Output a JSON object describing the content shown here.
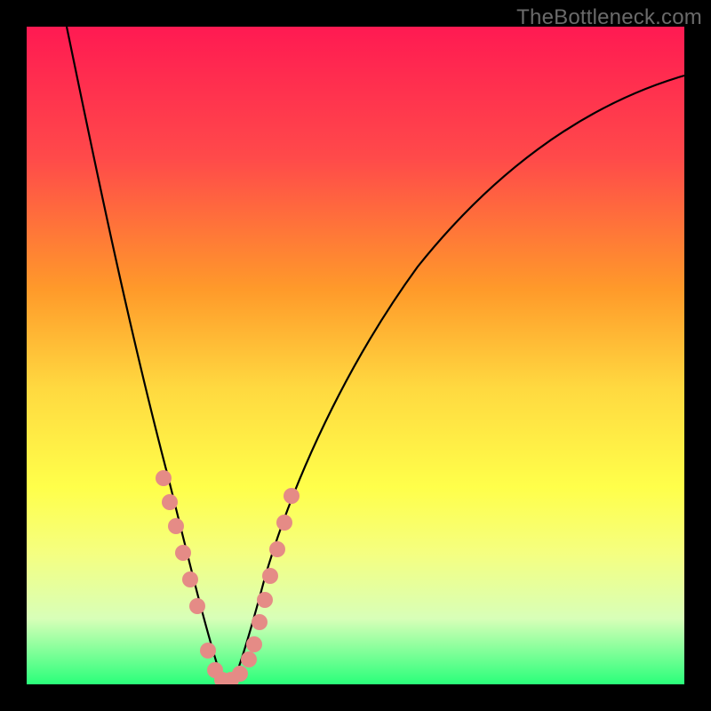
{
  "watermark": "TheBottleneck.com",
  "colors": {
    "frame": "#000000",
    "gradient_top": "#ff1a52",
    "gradient_mid1": "#ffd940",
    "gradient_mid2": "#ffff4a",
    "gradient_bottom": "#2aff7a",
    "curve": "#000000",
    "dots": "#e58b86"
  },
  "chart_data": {
    "type": "line",
    "title": "",
    "xlabel": "",
    "ylabel": "",
    "xlim": [
      0,
      100
    ],
    "ylim": [
      0,
      100
    ],
    "series": [
      {
        "name": "bottleneck-curve",
        "x": [
          6,
          8,
          10,
          12,
          14,
          16,
          18,
          20,
          22,
          24,
          26,
          27,
          28,
          29,
          30,
          32,
          34,
          36,
          38,
          40,
          45,
          50,
          55,
          60,
          70,
          80,
          90,
          100
        ],
        "y": [
          100,
          92,
          84,
          76,
          68,
          60,
          52,
          44,
          36,
          28,
          18,
          12,
          6,
          2,
          0,
          4,
          10,
          18,
          24,
          30,
          42,
          52,
          60,
          66,
          76,
          83,
          88,
          91
        ],
        "note": "y=0 is the bottom (optimal/green), y=100 is top (worst/red); the minimum of the V-curve sits near x≈29"
      }
    ],
    "markers": {
      "name": "highlight-dots",
      "x": [
        20,
        21,
        22,
        23,
        24,
        25,
        27,
        28,
        29,
        30,
        31,
        32,
        32.5,
        33,
        33.5,
        34,
        35,
        35.5,
        36
      ],
      "y": [
        44,
        40,
        35,
        30,
        24,
        18,
        5,
        2,
        0,
        0,
        2,
        5,
        10,
        16,
        22,
        28,
        34,
        38,
        42
      ],
      "note": "salmon dots clustered around the valley of the curve"
    }
  }
}
